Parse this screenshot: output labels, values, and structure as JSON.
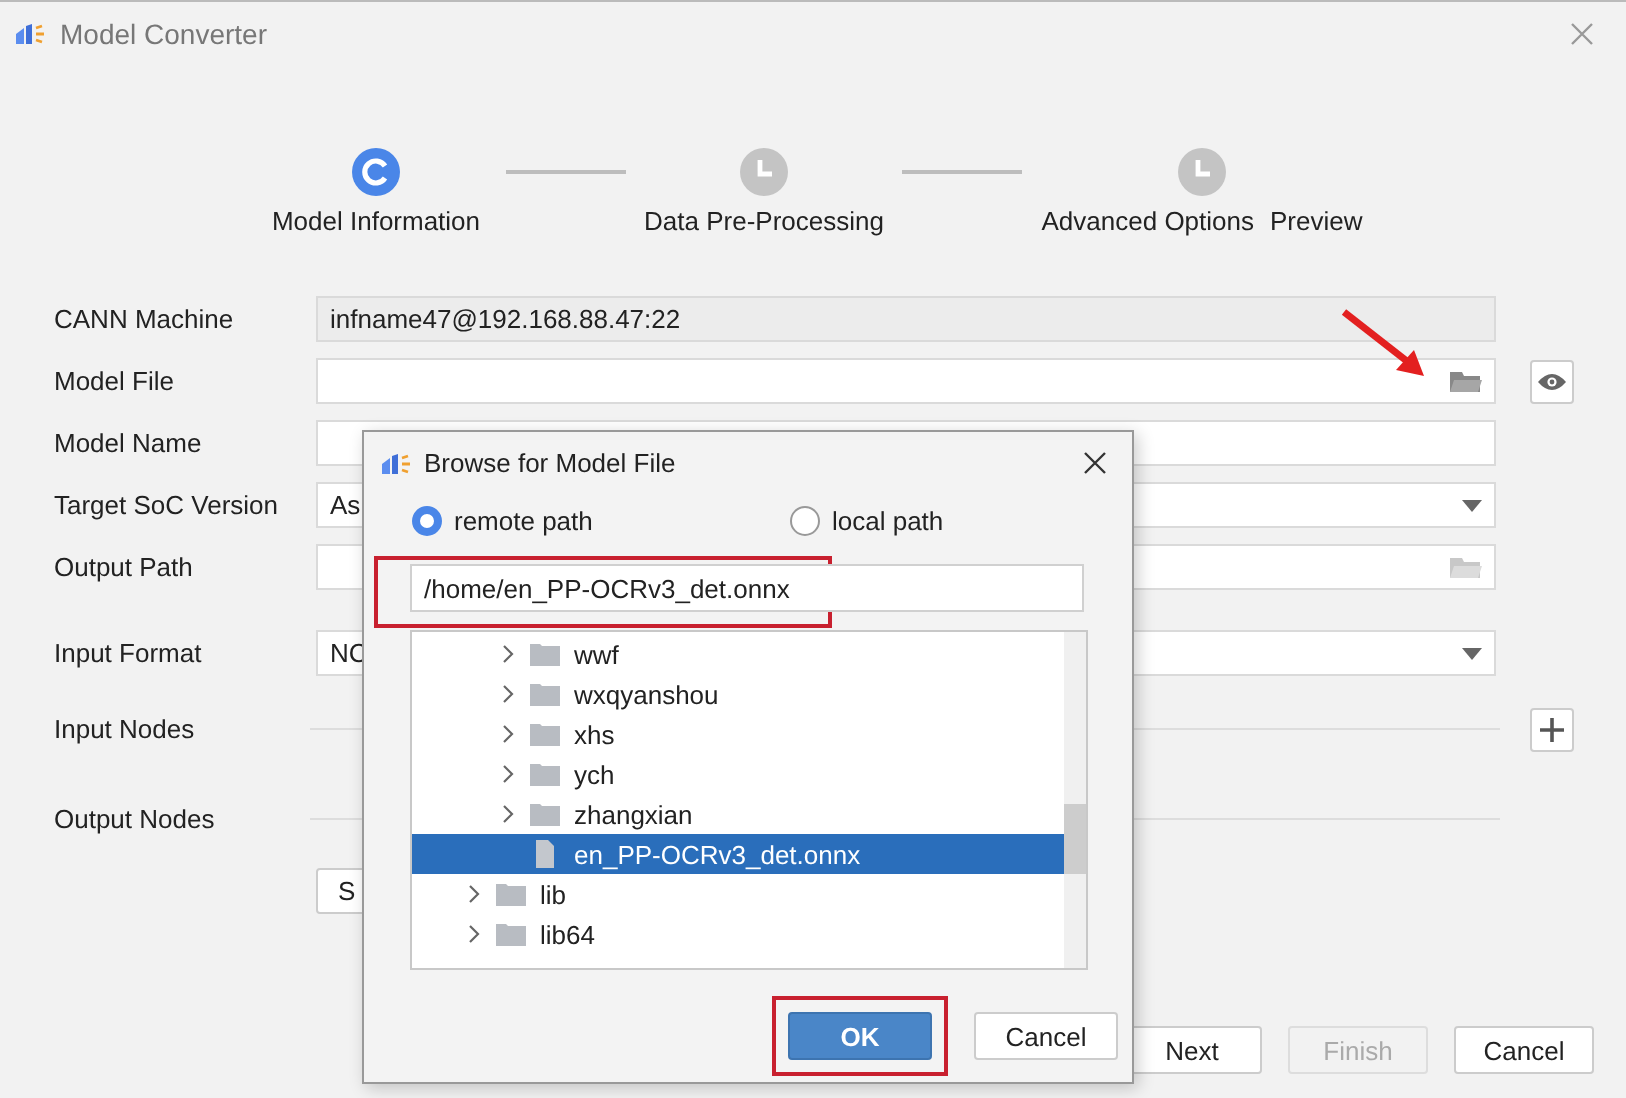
{
  "window": {
    "title": "Model Converter"
  },
  "stepper": {
    "steps": [
      {
        "label": "Model Information",
        "selected": true
      },
      {
        "label": "Data Pre-Processing",
        "selected": false
      },
      {
        "label": "Advanced Options",
        "selected": false
      }
    ],
    "trailing_label": "Preview"
  },
  "form": {
    "general": [
      {
        "label": "CANN Machine",
        "kind": "readonly",
        "value": "infname47@192.168.88.47:22"
      },
      {
        "label": "Model File",
        "kind": "file",
        "highlighted": true,
        "enabled": true
      },
      {
        "label": "Model Name",
        "kind": "text"
      },
      {
        "label": "Target SoC Version",
        "kind": "select",
        "value": "As"
      },
      {
        "label": "Output Path",
        "kind": "file",
        "highlighted": false,
        "enabled": false
      }
    ],
    "io": [
      {
        "label": "Input Format",
        "kind": "select",
        "value": "NC"
      },
      {
        "label": "Input Nodes",
        "kind": "nodes",
        "addable": true
      },
      {
        "label": "Output Nodes",
        "kind": "nodes",
        "addable": false
      }
    ],
    "extra_button": "S"
  },
  "footer_buttons": [
    {
      "label": "Next",
      "disabled": false
    },
    {
      "label": "Finish",
      "disabled": true
    },
    {
      "label": "Cancel",
      "disabled": false
    }
  ],
  "dialog": {
    "title": "Browse for Model File",
    "sources": [
      {
        "label": "remote path",
        "selected": true
      },
      {
        "label": "local path",
        "selected": false
      }
    ],
    "path": {
      "value": "/home/en_PP-OCRv3_det.onnx",
      "highlighted": true
    },
    "tree": {
      "scrolled_children": [
        {
          "name": "wwf",
          "kind": "folder",
          "expanded": false,
          "selected": false
        },
        {
          "name": "wxqyanshou",
          "kind": "folder",
          "expanded": false,
          "selected": false
        },
        {
          "name": "xhs",
          "kind": "folder",
          "expanded": false,
          "selected": false
        },
        {
          "name": "ych",
          "kind": "folder",
          "expanded": false,
          "selected": false
        },
        {
          "name": "zhangxian",
          "kind": "folder",
          "expanded": false,
          "selected": false
        },
        {
          "name": "en_PP-OCRv3_det.onnx",
          "kind": "file",
          "selected": true
        }
      ],
      "items": [
        {
          "name": "lib",
          "kind": "folder",
          "expanded": false,
          "selected": false
        },
        {
          "name": "lib64",
          "kind": "folder",
          "expanded": false,
          "selected": false
        }
      ]
    },
    "buttons": [
      {
        "label": "OK",
        "primary": true,
        "highlighted": true
      },
      {
        "label": "Cancel",
        "primary": false,
        "highlighted": false
      }
    ]
  }
}
